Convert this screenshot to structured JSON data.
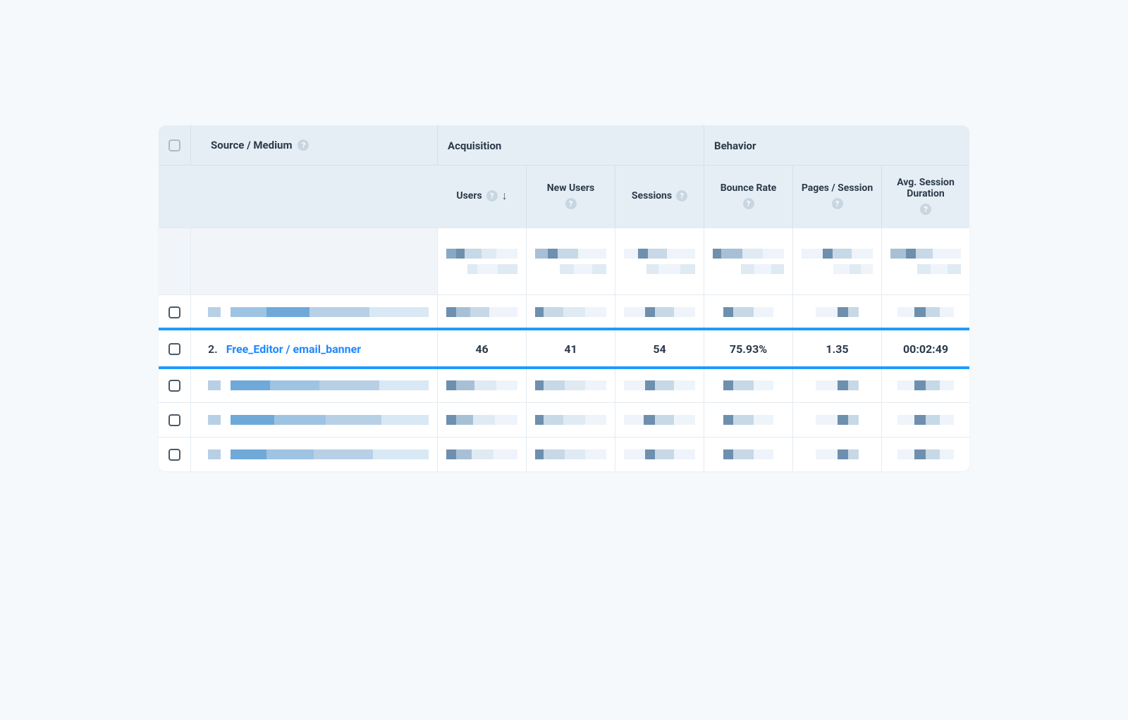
{
  "header": {
    "source_medium_label": "Source / Medium",
    "groups": {
      "acquisition": "Acquisition",
      "behavior": "Behavior"
    },
    "columns": {
      "users": "Users",
      "new_users": "New Users",
      "sessions": "Sessions",
      "bounce_rate": "Bounce Rate",
      "pages_session": "Pages / Session",
      "avg_session_duration": "Avg. Session Duration"
    },
    "sorted_column": "users",
    "sort_direction": "desc",
    "help_glyph": "?"
  },
  "highlighted_row": {
    "index_label": "2.",
    "source_medium": "Free_Editor / email_banner",
    "users": "46",
    "new_users": "41",
    "sessions": "54",
    "bounce_rate": "75.93%",
    "pages_session": "1.35",
    "avg_session_duration": "00:02:49"
  }
}
